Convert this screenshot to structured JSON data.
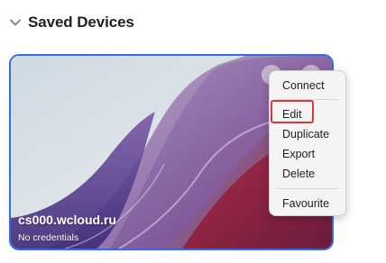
{
  "section": {
    "title": "Saved Devices",
    "chevron_icon": "chevron-down-icon"
  },
  "device": {
    "host": "cs000.wcloud.ru",
    "credentials": "No credentials",
    "selected": true,
    "accent": "#2f6fe0"
  },
  "context_menu": {
    "items": [
      {
        "label": "Connect"
      },
      {
        "label": "Edit"
      },
      {
        "label": "Duplicate"
      },
      {
        "label": "Export"
      },
      {
        "label": "Delete"
      },
      {
        "label": "Favourite"
      }
    ],
    "highlighted_item": "Edit",
    "highlight_color": "#d83a3a"
  }
}
